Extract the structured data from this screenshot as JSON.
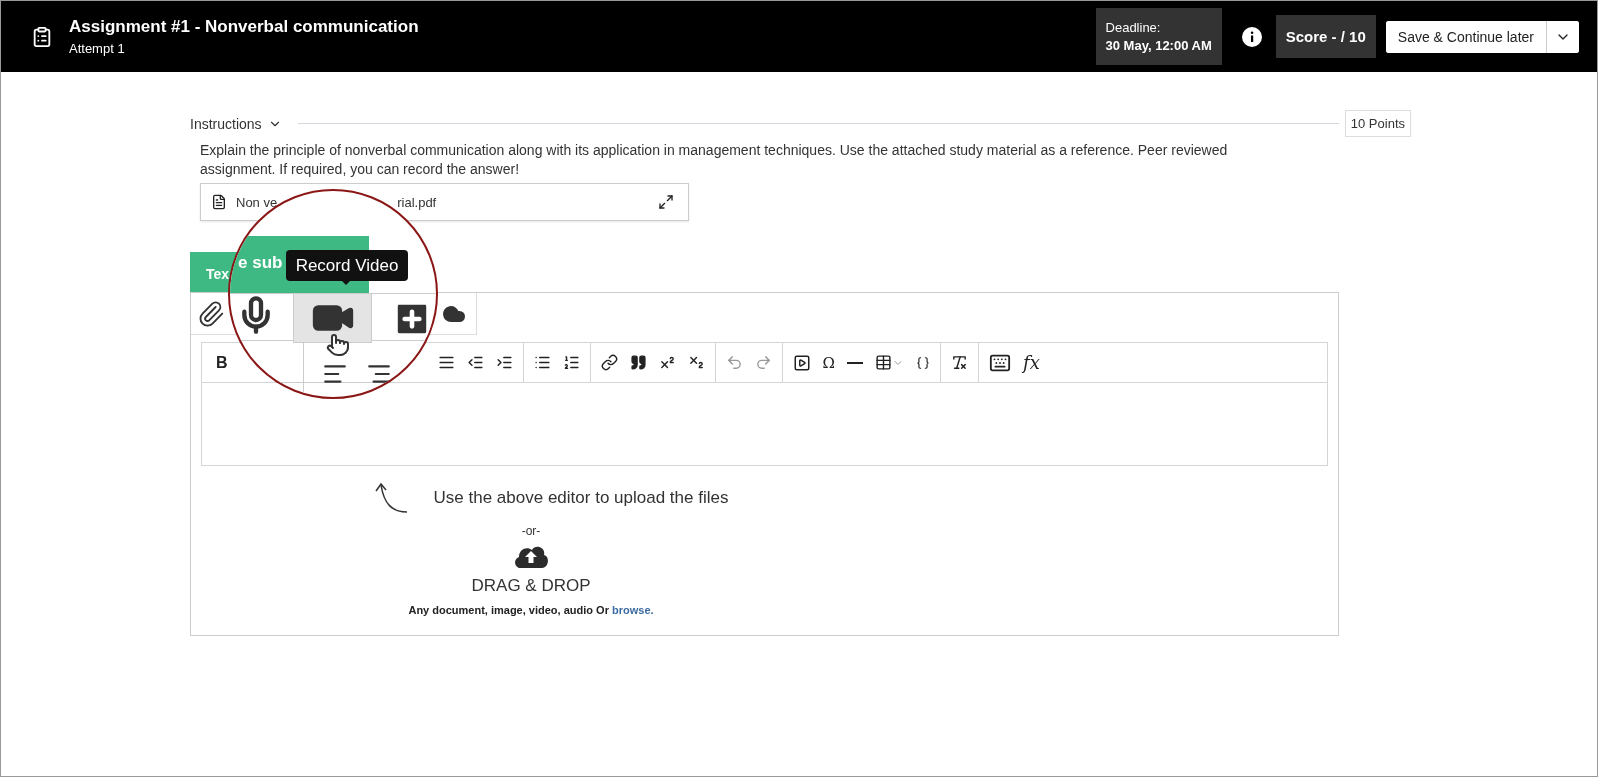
{
  "header": {
    "title": "Assignment #1 - Nonverbal communication",
    "subtitle": "Attempt 1",
    "deadline_label": "Deadline:",
    "deadline_value": "30 May, 12:00 AM",
    "score": "Score - / 10",
    "save_button": "Save & Continue later"
  },
  "instructions": {
    "label": "Instructions",
    "points": "10 Points",
    "text": "Explain the principle of nonverbal communication along with its application in management techniques. Use the attached study material as a reference. Peer reviewed assignment. If required, you can record the answer!",
    "attachment_start": "Non ve",
    "attachment_end": "rial.pdf"
  },
  "submission_tab": {
    "label": "Tex"
  },
  "magnifier": {
    "tab_label": "e sub",
    "tooltip": "Record Video",
    "video_button_hovered": true
  },
  "toolbar": {
    "bold": "B",
    "special_char": "Ω",
    "formula": "fx"
  },
  "dropzone": {
    "hint": "Use the above editor to upload the files",
    "or": "-or-",
    "title": "DRAG & DROP",
    "note": "Any document, image, video, audio Or ",
    "link": "browse."
  }
}
